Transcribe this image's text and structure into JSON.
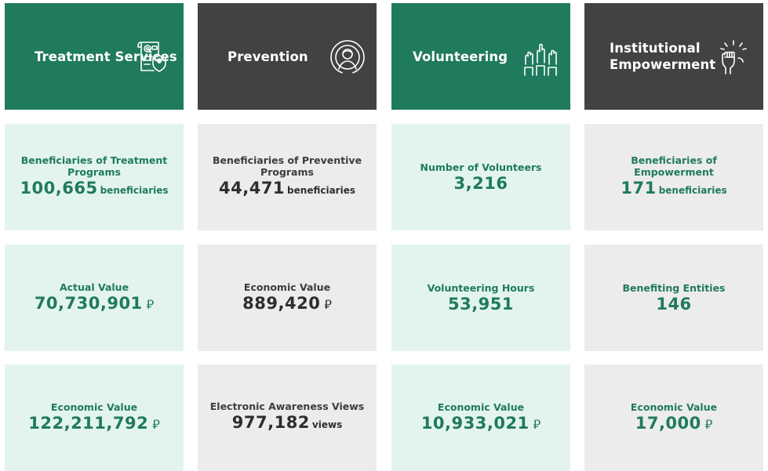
{
  "colors": {
    "green": "#1f7a5e",
    "dark": "#424242",
    "light_green": "#e3f4ee",
    "light_gray": "#ececec"
  },
  "columns": [
    {
      "title": "Treatment Services",
      "icon": "medical-document-shield-icon",
      "cards": [
        {
          "label": "Beneficiaries of Treatment Programs",
          "value": "100,665",
          "unit": "beneficiaries"
        },
        {
          "label": "Actual Value",
          "value": "70,730,901",
          "currency": "⃁"
        },
        {
          "label": "Economic Value",
          "value": "122,211,792",
          "currency": "⃁"
        }
      ]
    },
    {
      "title": "Prevention",
      "icon": "person-target-icon",
      "cards": [
        {
          "label": "Beneficiaries of Preventive Programs",
          "value": "44,471",
          "unit": "beneficiaries"
        },
        {
          "label": "Economic Value",
          "value": "889,420",
          "currency": "⃁"
        },
        {
          "label": "Electronic Awareness Views",
          "value": "977,182",
          "unit": "views"
        }
      ]
    },
    {
      "title": "Volunteering",
      "icon": "raised-hands-icon",
      "cards": [
        {
          "label": "Number of Volunteers",
          "value": "3,216"
        },
        {
          "label": "Volunteering Hours",
          "value": "53,951"
        },
        {
          "label": "Economic Value",
          "value": "10,933,021",
          "currency": "⃁"
        }
      ]
    },
    {
      "title": "Institutional Empowerment",
      "icon": "raised-fist-icon",
      "cards": [
        {
          "label": "Beneficiaries of Empowerment",
          "value": "171",
          "unit": "beneficiaries"
        },
        {
          "label": "Benefiting Entities",
          "value": "146"
        },
        {
          "label": "Economic Value",
          "value": "17,000",
          "currency": "⃁"
        }
      ]
    }
  ]
}
